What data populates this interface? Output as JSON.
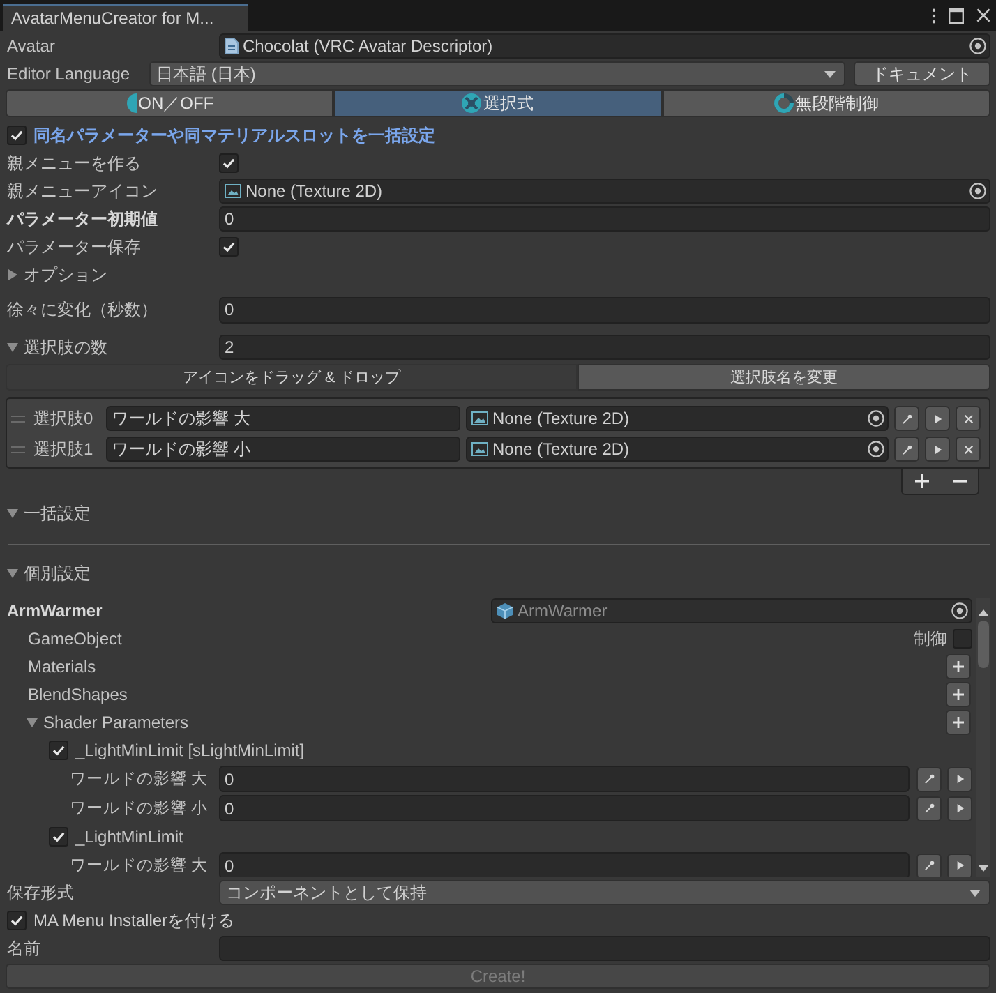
{
  "window": {
    "tab_title": "AvatarMenuCreator for M..."
  },
  "avatar": {
    "label": "Avatar",
    "value": "Chocolat (VRC Avatar Descriptor)"
  },
  "editor_language": {
    "label": "Editor Language",
    "value": "日本語 (日本)",
    "button": "ドキュメント"
  },
  "mode_tabs": [
    {
      "kind": "toggle",
      "label": "ON／OFF",
      "selected": false
    },
    {
      "kind": "choice",
      "label": "選択式",
      "selected": true
    },
    {
      "kind": "radial",
      "label": "無段階制御",
      "selected": false
    }
  ],
  "bulk_option": {
    "label": "同名パラメーターや同マテリアルスロットを一括設定",
    "checked": true
  },
  "settings": [
    {
      "kind": "checkbox",
      "label": "親メニューを作る",
      "bold": false,
      "checked": true
    },
    {
      "kind": "object",
      "label": "親メニューアイコン",
      "bold": false,
      "value": "None (Texture 2D)"
    },
    {
      "kind": "number",
      "label": "パラメーター初期値",
      "bold": true,
      "value": "0"
    },
    {
      "kind": "checkbox",
      "label": "パラメーター保存",
      "bold": false,
      "checked": true
    },
    {
      "kind": "foldout",
      "label": "オプション",
      "bold": false,
      "expanded": false
    }
  ],
  "transition": {
    "label": "徐々に変化（秒数）",
    "value": "0"
  },
  "choice_count": {
    "label": "選択肢の数",
    "expanded": true,
    "value": "2"
  },
  "choice_toolbar": [
    {
      "label": "アイコンをドラッグ & ドロップ",
      "selected": true
    },
    {
      "label": "選択肢名を変更",
      "selected": false
    }
  ],
  "choices": [
    {
      "label": "選択肢0",
      "name": "ワールドの影響 大",
      "icon": "None (Texture 2D)"
    },
    {
      "label": "選択肢1",
      "name": "ワールドの影響 小",
      "icon": "None (Texture 2D)"
    }
  ],
  "sections": [
    {
      "label": "一括設定",
      "expanded": true
    },
    {
      "label": "個別設定",
      "expanded": true
    }
  ],
  "object_settings": {
    "name": "ArmWarmer",
    "object": {
      "value": "ArmWarmer",
      "disabled": true
    },
    "rows": [
      {
        "kind": "toggle",
        "label": "GameObject",
        "toggle_label": "制御",
        "checked": false
      },
      {
        "kind": "add",
        "label": "Materials"
      },
      {
        "kind": "add",
        "label": "BlendShapes"
      },
      {
        "kind": "group",
        "label": "Shader Parameters",
        "expanded": true,
        "children": [
          {
            "label": "_LightMinLimit [sLightMinLimit]",
            "checked": true,
            "children": [
              {
                "label": "ワールドの影響 大",
                "value": "0"
              },
              {
                "label": "ワールドの影響 小",
                "value": "0"
              }
            ]
          },
          {
            "label": "_LightMinLimit",
            "checked": true,
            "children": [
              {
                "label": "ワールドの影響 大",
                "value": "0"
              }
            ]
          }
        ]
      }
    ]
  },
  "save_format": {
    "label": "保存形式",
    "value": "コンポーネントとして保持"
  },
  "ma_installer": {
    "label": "MA Menu Installerを付ける",
    "checked": true
  },
  "name_field": {
    "label": "名前"
  },
  "create_button": {
    "label": "Create!",
    "disabled": true
  }
}
